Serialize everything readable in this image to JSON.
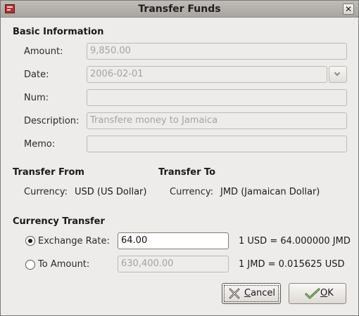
{
  "window": {
    "title": "Transfer Funds"
  },
  "basic": {
    "heading": "Basic Information",
    "amount_label": "Amount:",
    "amount_value": "9,850.00",
    "date_label": "Date:",
    "date_value": "2006-02-01",
    "num_label": "Num:",
    "num_value": "",
    "description_label": "Description:",
    "description_value": "Transfere money to Jamaica",
    "memo_label": "Memo:",
    "memo_value": ""
  },
  "transfer_from": {
    "heading": "Transfer From",
    "currency_label": "Currency:",
    "currency_value": "USD (US Dollar)"
  },
  "transfer_to": {
    "heading": "Transfer To",
    "currency_label": "Currency:",
    "currency_value": "JMD (Jamaican Dollar)"
  },
  "currency_transfer": {
    "heading": "Currency Transfer",
    "exchange_rate_label": "Exchange Rate:",
    "exchange_rate_value": "64.00",
    "exchange_rate_selected": true,
    "exchange_rate_note": "1 USD = 64.000000 JMD",
    "to_amount_label": "To Amount:",
    "to_amount_value": "630,400.00",
    "to_amount_note": "1 JMD = 0.015625 USD"
  },
  "buttons": {
    "cancel_label_prefix": "C",
    "cancel_label_rest": "ancel",
    "ok_label_prefix": "O",
    "ok_label_rest": "K"
  },
  "icons": {
    "app": "gnucash-app-icon",
    "close": "close-icon",
    "dropdown": "chevron-down-icon",
    "cancel": "cancel-x-icon",
    "ok": "ok-check-icon"
  }
}
